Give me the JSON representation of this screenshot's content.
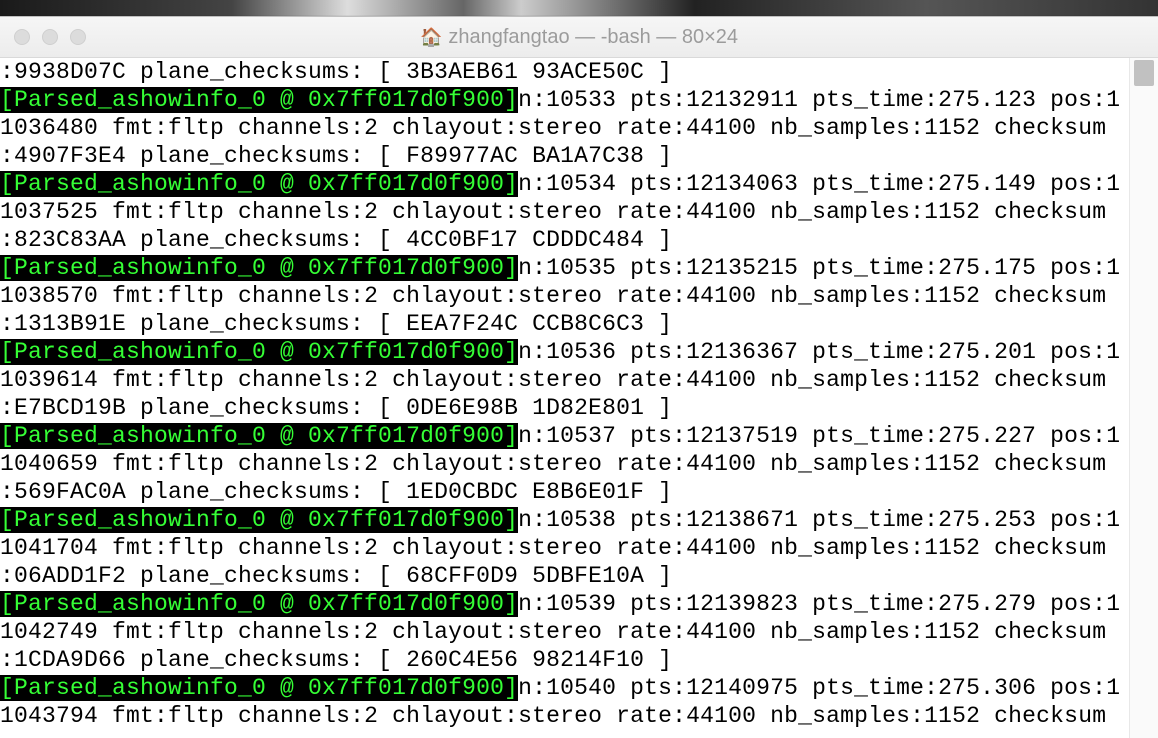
{
  "window": {
    "title": "zhangfangtao — -bash — 80×24",
    "icon": "home-icon"
  },
  "parsed_prefix": "[Parsed_ashowinfo_0 @ 0x7ff017d0f900]",
  "first_tail": ":9938D07C plane_checksums: [ 3B3AEB61 93ACE50C ]",
  "frames": [
    {
      "n": 10533,
      "pts": 12132911,
      "pts_time": "275.123",
      "pos": 11036480,
      "fmt": "fltp",
      "channels": 2,
      "chlayout": "stereo",
      "rate": 44100,
      "nb_samples": 1152,
      "checksum": "4907F3E4",
      "plane_checksums": [
        "F89977AC",
        "BA1A7C38"
      ]
    },
    {
      "n": 10534,
      "pts": 12134063,
      "pts_time": "275.149",
      "pos": 11037525,
      "fmt": "fltp",
      "channels": 2,
      "chlayout": "stereo",
      "rate": 44100,
      "nb_samples": 1152,
      "checksum": "823C83AA",
      "plane_checksums": [
        "4CC0BF17",
        "CDDDC484"
      ]
    },
    {
      "n": 10535,
      "pts": 12135215,
      "pts_time": "275.175",
      "pos": 11038570,
      "fmt": "fltp",
      "channels": 2,
      "chlayout": "stereo",
      "rate": 44100,
      "nb_samples": 1152,
      "checksum": "1313B91E",
      "plane_checksums": [
        "EEA7F24C",
        "CCB8C6C3"
      ]
    },
    {
      "n": 10536,
      "pts": 12136367,
      "pts_time": "275.201",
      "pos": 11039614,
      "fmt": "fltp",
      "channels": 2,
      "chlayout": "stereo",
      "rate": 44100,
      "nb_samples": 1152,
      "checksum": "E7BCD19B",
      "plane_checksums": [
        "0DE6E98B",
        "1D82E801"
      ]
    },
    {
      "n": 10537,
      "pts": 12137519,
      "pts_time": "275.227",
      "pos": 11040659,
      "fmt": "fltp",
      "channels": 2,
      "chlayout": "stereo",
      "rate": 44100,
      "nb_samples": 1152,
      "checksum": "569FAC0A",
      "plane_checksums": [
        "1ED0CBDC",
        "E8B6E01F"
      ]
    },
    {
      "n": 10538,
      "pts": 12138671,
      "pts_time": "275.253",
      "pos": 11041704,
      "fmt": "fltp",
      "channels": 2,
      "chlayout": "stereo",
      "rate": 44100,
      "nb_samples": 1152,
      "checksum": "06ADD1F2",
      "plane_checksums": [
        "68CFF0D9",
        "5DBFE10A"
      ]
    },
    {
      "n": 10539,
      "pts": 12139823,
      "pts_time": "275.279",
      "pos": 11042749,
      "fmt": "fltp",
      "channels": 2,
      "chlayout": "stereo",
      "rate": 44100,
      "nb_samples": 1152,
      "checksum": "1CDA9D66",
      "plane_checksums": [
        "260C4E56",
        "98214F10"
      ]
    },
    {
      "n": 10540,
      "pts": 12140975,
      "pts_time": "275.306",
      "pos": 11043794,
      "fmt": "fltp",
      "channels": 2,
      "chlayout": "stereo",
      "rate": 44100,
      "nb_samples": 1152,
      "checksum": null,
      "plane_checksums": null
    }
  ]
}
